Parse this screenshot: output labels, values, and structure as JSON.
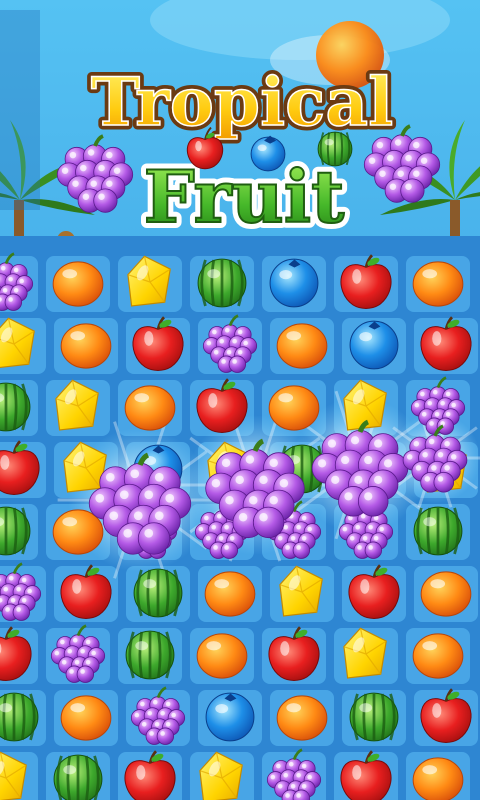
{
  "title": {
    "line1": "Tropical",
    "line2": "Fruit"
  },
  "colors": {
    "sky": "#3aa9e6",
    "board": "#2f8fd9",
    "tile": "#5fc0f5",
    "title_yellow": "#ffd21f",
    "title_green": "#3fae2a",
    "title_outline": "#6b3a12"
  },
  "board": {
    "rows": [
      [
        "grapes",
        "orange",
        "star",
        "melon",
        "blueberry",
        "apple",
        "orange"
      ],
      [
        "star",
        "orange",
        "apple",
        "grapes",
        "orange",
        "blueberry",
        "apple"
      ],
      [
        "melon",
        "star",
        "orange",
        "apple",
        "orange",
        "star",
        "grapes"
      ],
      [
        "apple",
        "star",
        "blueberry",
        "star",
        "melon",
        "orange",
        "star"
      ],
      [
        "melon",
        "orange",
        "grapes",
        "grapes",
        "grapes",
        "grapes",
        "melon"
      ],
      [
        "grapes",
        "apple",
        "melon",
        "orange",
        "star",
        "apple",
        "orange"
      ],
      [
        "apple",
        "grapes",
        "melon",
        "orange",
        "apple",
        "star",
        "orange"
      ],
      [
        "melon",
        "orange",
        "grapes",
        "blueberry",
        "orange",
        "melon",
        "apple"
      ],
      [
        "star",
        "melon",
        "apple",
        "star",
        "grapes",
        "apple",
        "orange"
      ]
    ],
    "highlighted_match": "grapes"
  }
}
